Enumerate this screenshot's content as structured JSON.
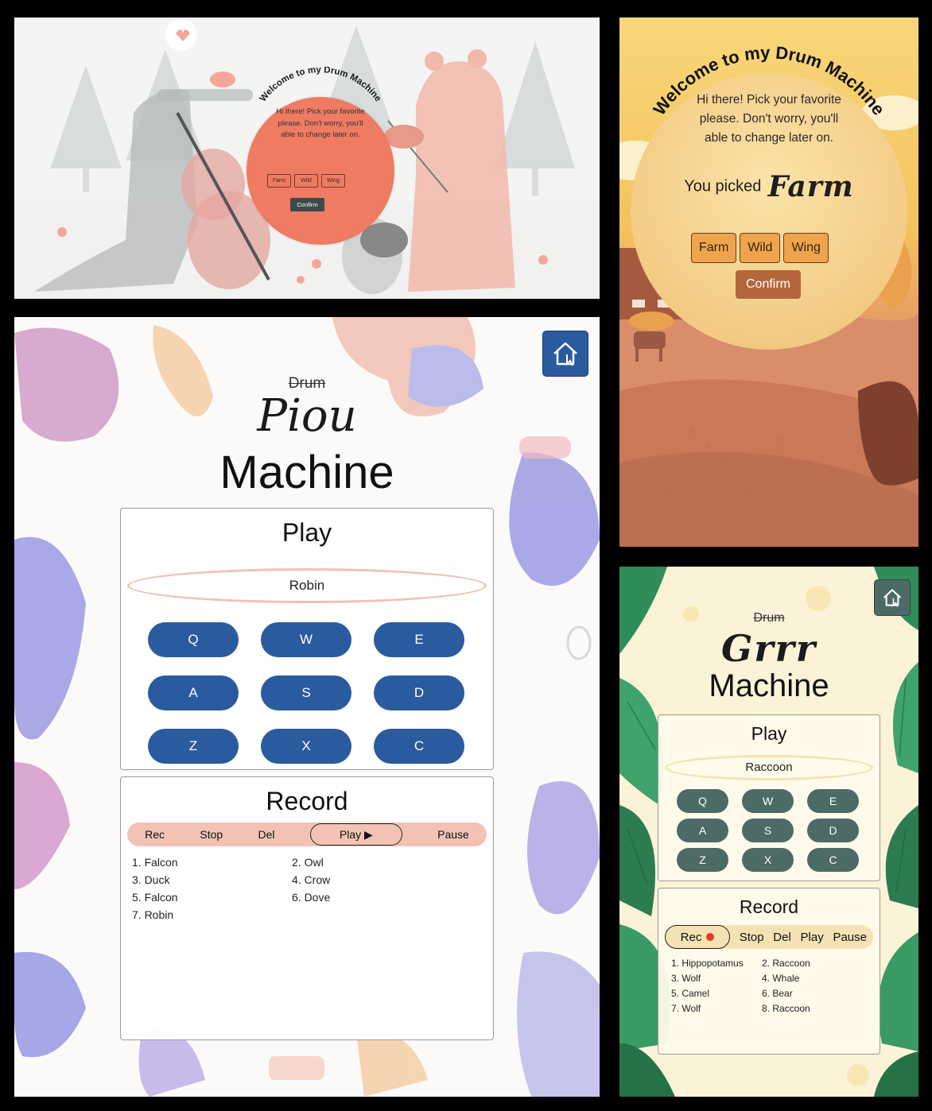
{
  "welcome_bear": {
    "title": "Welcome to my Drum Machine",
    "intro": "Hi there! Pick your favorite please. Don't worry, you'll able to change later on.",
    "options": [
      "Farm",
      "Wild",
      "Wing"
    ],
    "confirm": "Confirm"
  },
  "welcome_farm": {
    "title": "Welcome to my Drum Machine",
    "intro": "Hi there! Pick your favorite please. Don't worry, you'll able to change later on.",
    "picked_label": "You picked",
    "picked_value": "Farm",
    "options": [
      "Farm",
      "Wild",
      "Wing"
    ],
    "confirm": "Confirm"
  },
  "piou": {
    "title_struck": "Drum",
    "title_word": "Piou",
    "title_machine": "Machine",
    "home_icon": "home-icon",
    "play_heading": "Play",
    "current_sound": "Robin",
    "keys": [
      "Q",
      "W",
      "E",
      "A",
      "S",
      "D",
      "Z",
      "X",
      "C"
    ],
    "record_heading": "Record",
    "record_controls": {
      "rec": "Rec",
      "stop": "Stop",
      "del": "Del",
      "play": "Play ▶",
      "pause": "Pause"
    },
    "recordings": [
      "1. Falcon",
      "2. Owl",
      "3. Duck",
      "4. Crow",
      "5. Falcon",
      "6. Dove",
      "7. Robin"
    ],
    "colors": {
      "key": "#2a5b9f",
      "accent": "#f2c3b5"
    }
  },
  "grrr": {
    "title_struck": "Drum",
    "title_word": "Grrr",
    "title_machine": "Machine",
    "home_icon": "home-icon",
    "play_heading": "Play",
    "current_sound": "Raccoon",
    "keys": [
      "Q",
      "W",
      "E",
      "A",
      "S",
      "D",
      "Z",
      "X",
      "C"
    ],
    "record_heading": "Record",
    "record_controls": {
      "rec": "Rec",
      "stop": "Stop",
      "del": "Del",
      "play": "Play",
      "pause": "Pause"
    },
    "recordings": [
      "1. Hippopotamus",
      "2. Raccoon",
      "3. Wolf",
      "4. Whale",
      "5. Camel",
      "6. Bear",
      "7. Wolf",
      "8. Raccoon"
    ],
    "colors": {
      "key": "#4c6b67",
      "accent": "#f5e2b4",
      "rec_dot": "#e53a2a"
    }
  }
}
